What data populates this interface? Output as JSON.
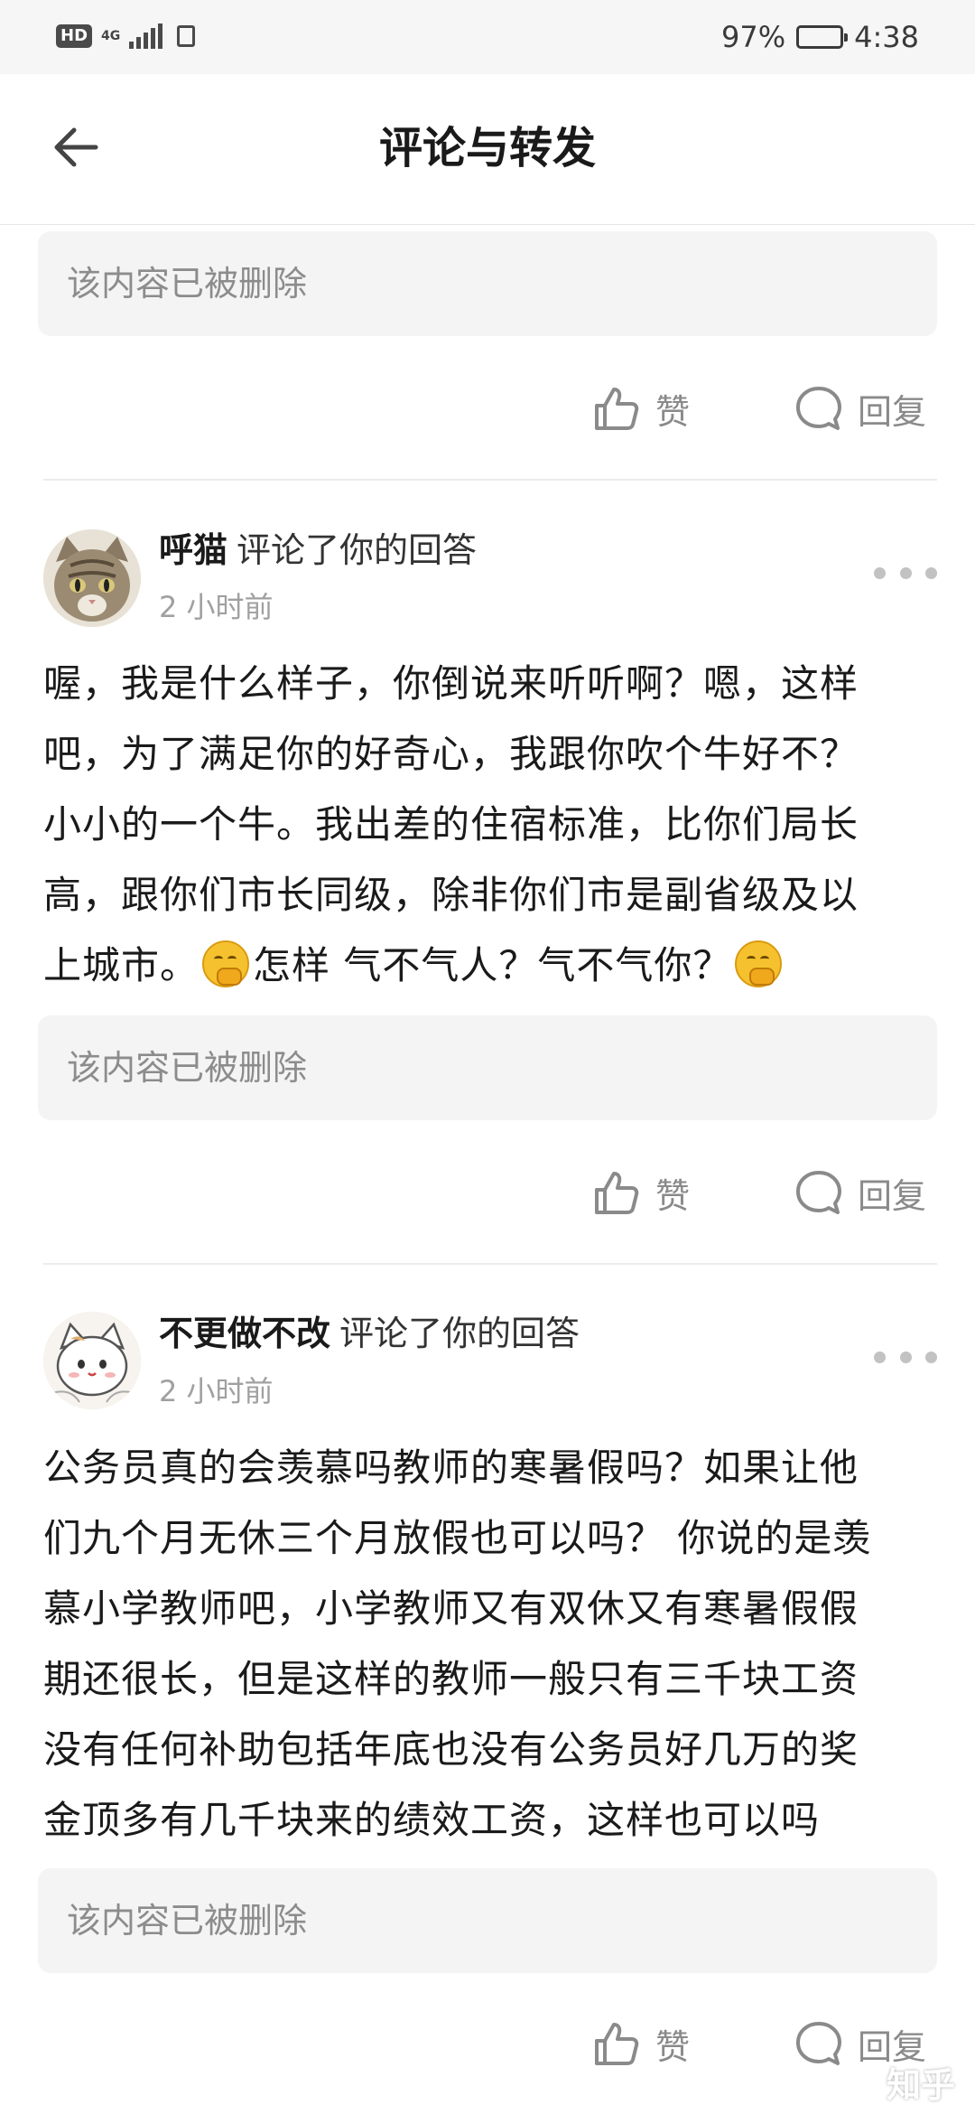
{
  "status_bar": {
    "hd": "HD",
    "network": "4G",
    "battery": "97%",
    "battery_level": 0.97,
    "time": "4:38"
  },
  "header": {
    "title": "评论与转发",
    "back_icon": "arrow-left-icon"
  },
  "deleted_text": "该内容已被删除",
  "actions": {
    "like_label": "赞",
    "reply_label": "回复"
  },
  "comments": [
    {
      "author": "呼猫",
      "action": "评论了你的回答",
      "time": "2 小时前",
      "avatar": "tabby-cat-avatar",
      "lines": [
        "喔，我是什么样子，你倒说来听听啊？嗯，这样",
        "吧，为了满足你的好奇心，我跟你吹个牛好不？",
        "小小的一个牛。我出差的住宿标准，比你们局长",
        "高，跟你们市长同级，除非你们市是副省级及以"
      ],
      "last_line_parts": [
        "上城市。",
        "怎样 气不气人？气不气你？"
      ]
    },
    {
      "author": "不更做不改",
      "action": "评论了你的回答",
      "time": "2 小时前",
      "avatar": "cartoon-cat-avatar",
      "lines": [
        "公务员真的会羡慕吗教师的寒暑假吗？如果让他",
        "们九个月无休三个月放假也可以吗？ 你说的是羡",
        "慕小学教师吧，小学教师又有双休又有寒暑假假",
        "期还很长，但是这样的教师一般只有三千块工资",
        "没有任何补助包括年底也没有公务员好几万的奖",
        "金顶多有几千块来的绩效工资，这样也可以吗"
      ]
    }
  ],
  "watermark": "知乎"
}
